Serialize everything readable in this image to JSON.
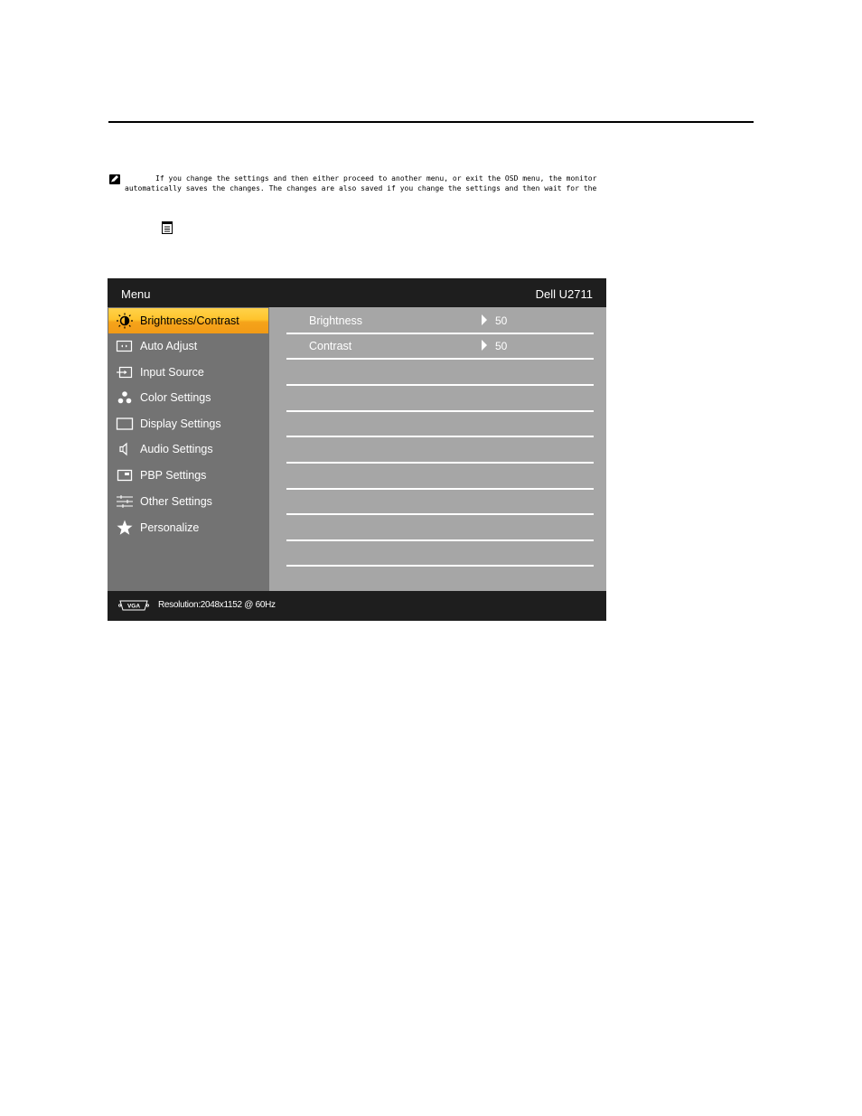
{
  "note": {
    "line1": "If you change the settings and then either proceed to another menu, or exit the OSD menu, the monitor",
    "line2": "automatically saves the changes. The changes are also saved if you change the settings and then wait for the",
    "icon": "note-pencil-icon"
  },
  "menu_button_icon": "menu-list-icon",
  "osd": {
    "title": "Menu",
    "model": "Dell U2711",
    "menu_items": [
      {
        "label": "Brightness/Contrast",
        "icon": "sun-icon",
        "active": true
      },
      {
        "label": "Auto Adjust",
        "icon": "auto-adjust-icon",
        "active": false
      },
      {
        "label": "Input Source",
        "icon": "input-source-icon",
        "active": false
      },
      {
        "label": "Color Settings",
        "icon": "color-dots-icon",
        "active": false
      },
      {
        "label": "Display Settings",
        "icon": "display-rectangle-icon",
        "active": false
      },
      {
        "label": "Audio Settings",
        "icon": "speaker-icon",
        "active": false
      },
      {
        "label": "PBP Settings",
        "icon": "pbp-icon",
        "active": false
      },
      {
        "label": "Other Settings",
        "icon": "sliders-icon",
        "active": false
      },
      {
        "label": "Personalize",
        "icon": "star-icon",
        "active": false
      }
    ],
    "options": [
      {
        "label": "Brightness",
        "value": "50"
      },
      {
        "label": "Contrast",
        "value": "50"
      }
    ],
    "footer": {
      "connector_icon": "vga-connector-icon",
      "resolution": "Resolution:2048x1152 @ 60Hz"
    },
    "colors": {
      "highlight": "#f5a31a",
      "panel_left": "#737373",
      "panel_right": "#a6a6a6",
      "bar": "#1e1e1e"
    }
  }
}
